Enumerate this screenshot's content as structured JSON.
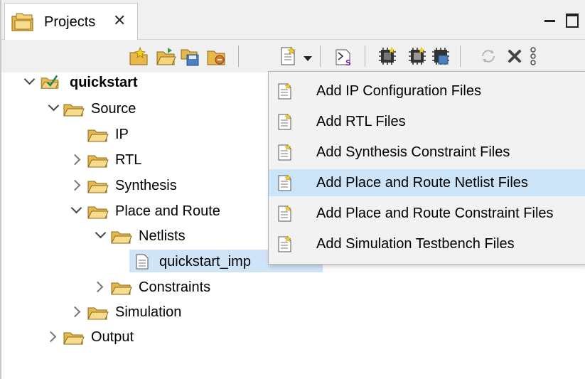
{
  "view": {
    "tab_label": "Projects",
    "close_glyph": "✕"
  },
  "toolbar": {
    "icons": [
      "new-project-icon",
      "open-project-icon",
      "save-project-icon",
      "close-project-icon",
      "add-file-icon",
      "dropdown-caret-icon",
      "settings-icon",
      "synthesize-icon",
      "place-route-icon",
      "generate-bitstream-icon",
      "refresh-icon",
      "delete-icon",
      "more-options-icon"
    ]
  },
  "tree": {
    "project": "quickstart",
    "source": "Source",
    "ip": "IP",
    "rtl": "RTL",
    "synthesis": "Synthesis",
    "place_route": "Place and Route",
    "netlists": "Netlists",
    "netlist_file": "quickstart_imp",
    "constraints": "Constraints",
    "simulation": "Simulation",
    "output": "Output"
  },
  "menu": {
    "items": [
      "Add IP Configuration Files",
      "Add RTL Files",
      "Add Synthesis Constraint Files",
      "Add Place and Route Netlist Files",
      "Add Place and Route Constraint Files",
      "Add Simulation Testbench Files"
    ],
    "highlighted_index": 3
  },
  "colors": {
    "folder": "#e8b84a",
    "selection": "#cfe4f7",
    "menu_highlight": "#cce4f7",
    "menu_bg": "#f2f2f2"
  }
}
